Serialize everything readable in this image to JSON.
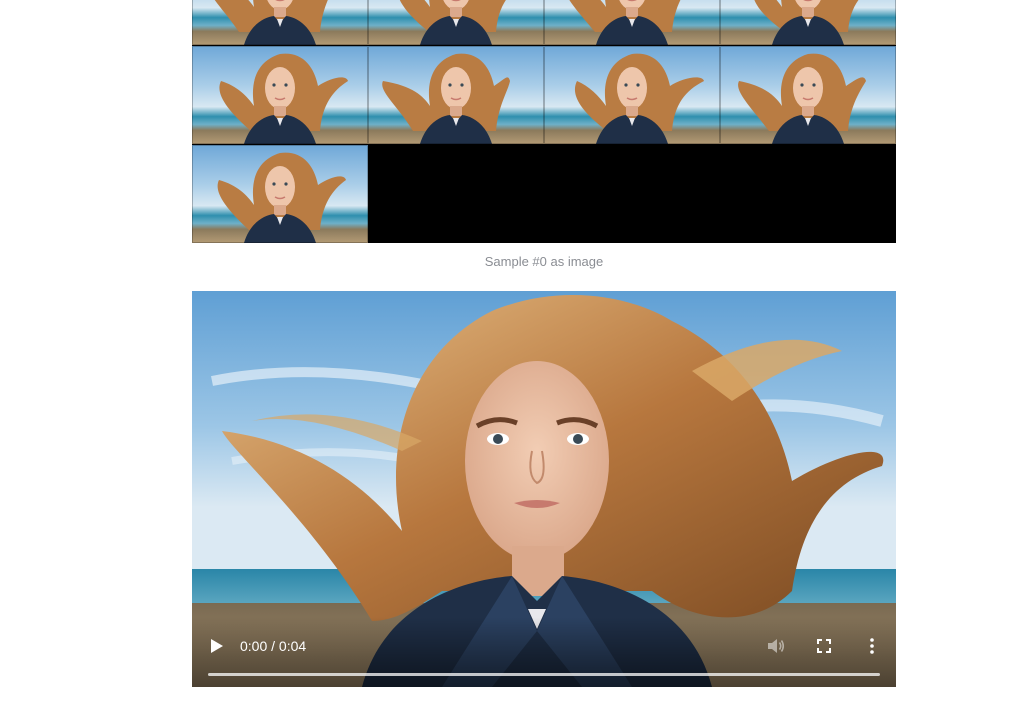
{
  "sample_grid": {
    "columns": 4,
    "rows": [
      {
        "tiles": 4
      },
      {
        "tiles": 4
      },
      {
        "tiles": 1
      }
    ],
    "tile_count": 9
  },
  "caption": "Sample #0 as image",
  "video": {
    "time_display": "0:00 / 0:04",
    "progress": 0,
    "playing": false,
    "icons": {
      "play": "play-icon",
      "volume": "volume-icon",
      "fullscreen": "fullscreen-icon",
      "more": "more-vertical-icon"
    }
  },
  "colors": {
    "caption": "#8a8d93",
    "page_background": "#ffffff",
    "letterbox": "#000000"
  }
}
